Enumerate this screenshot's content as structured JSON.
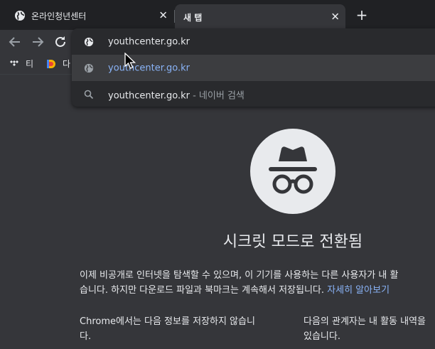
{
  "tabs": [
    {
      "title": "온라인청년센터",
      "close": "✕",
      "active": false
    },
    {
      "title": "새 탭",
      "close": "✕",
      "active": true
    }
  ],
  "newtab_label": "+",
  "bookmarks": [
    {
      "label": "티",
      "icon": "tidal-icon"
    },
    {
      "label": "다",
      "icon": "daum-icon"
    }
  ],
  "omnibox": {
    "input_value": "youthcenter.go.kr",
    "suggestion_url": "youthcenter.go.kr",
    "search_query": "youthcenter.go.kr",
    "search_suffix": "- 네이버 검색"
  },
  "incognito": {
    "title": "시크릿 모드로 전환됨",
    "intro_line1": "이제 비공개로 인터넷을 탐색할 수 있으며, 이 기기를 사용하는 다른 사용자가 내 활",
    "intro_line2": "습니다. 하지만 다운로드 파일과 북마크는 계속해서 저장됩니다.",
    "learn_more": "자세히 알아보기",
    "left_heading_line1": "Chrome에서는 다음 정보를 저장하지 않습니",
    "left_heading_line2": "다.",
    "right_heading_line1": "다음의 관계자는 내 활동 내역을",
    "right_heading_line2": "있습니다."
  },
  "colors": {
    "tabstrip": "#202124",
    "toolbar": "#35363a",
    "omnibox": "#292a2d",
    "link": "#8ab4f8"
  }
}
